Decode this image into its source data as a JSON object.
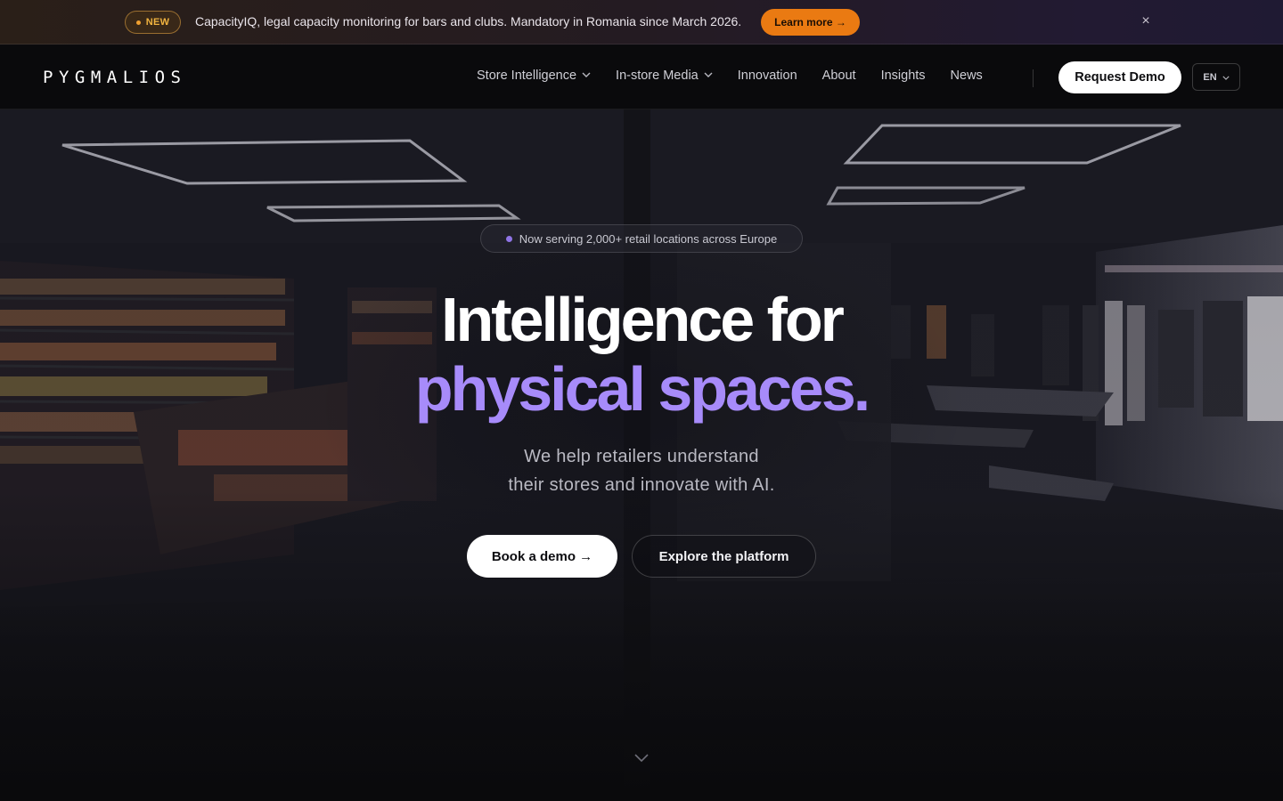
{
  "announcement": {
    "badge": "NEW",
    "text": "CapacityIQ, legal capacity monitoring for bars and clubs. Mandatory in Romania since March 2026.",
    "cta": "Learn more →",
    "close": "×"
  },
  "nav": {
    "logo": "PYGMALIOS",
    "links": [
      {
        "label": "Store Intelligence",
        "dropdown": true
      },
      {
        "label": "In-store Media",
        "dropdown": true
      },
      {
        "label": "Innovation",
        "dropdown": false
      },
      {
        "label": "About",
        "dropdown": false
      },
      {
        "label": "Insights",
        "dropdown": false
      },
      {
        "label": "News",
        "dropdown": false
      }
    ],
    "request_demo": "Request Demo",
    "language": "EN"
  },
  "hero": {
    "pill": "Now serving 2,000+ retail locations across Europe",
    "headline_line1": "Intelligence for",
    "headline_line2": "physical spaces.",
    "subhead_line1": "We help retailers understand",
    "subhead_line2": "their stores and innovate with AI.",
    "primary_cta": "Book a demo →",
    "secondary_cta": "Explore the platform"
  },
  "colors": {
    "accent_purple": "#a78bfa",
    "announce_cta": "#ea7a12",
    "badge_gold": "#f0b340"
  },
  "icons": {
    "chevron": "chevron-down-icon",
    "close": "close-icon",
    "scroll": "scroll-down-icon"
  }
}
